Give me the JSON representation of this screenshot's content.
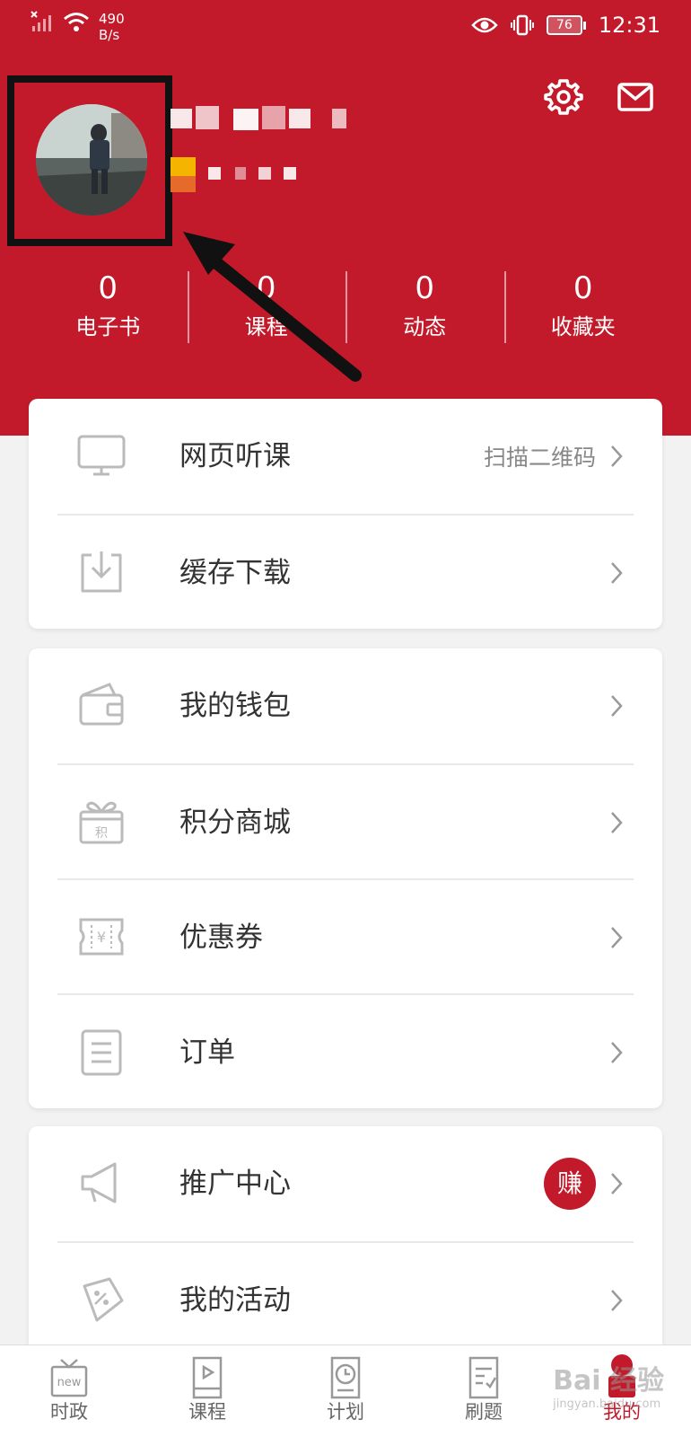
{
  "status_bar": {
    "net_speed_value": "490",
    "net_speed_unit": "B/s",
    "battery": "76",
    "time": "12:31"
  },
  "profile": {
    "stats": [
      {
        "value": "0",
        "label": "电子书"
      },
      {
        "value": "0",
        "label": "课程"
      },
      {
        "value": "0",
        "label": "动态"
      },
      {
        "value": "0",
        "label": "收藏夹"
      }
    ]
  },
  "cards": {
    "group1": [
      {
        "label": "网页听课",
        "hint": "扫描二维码",
        "icon": "monitor-icon"
      },
      {
        "label": "缓存下载",
        "icon": "download-icon"
      }
    ],
    "group2": [
      {
        "label": "我的钱包",
        "icon": "wallet-icon"
      },
      {
        "label": "积分商城",
        "icon": "gift-icon",
        "icon_text": "积"
      },
      {
        "label": "优惠券",
        "icon": "coupon-icon",
        "icon_text": "¥"
      },
      {
        "label": "订单",
        "icon": "order-icon"
      }
    ],
    "group3": [
      {
        "label": "推广中心",
        "badge": "赚",
        "icon": "megaphone-icon"
      },
      {
        "label": "我的活动",
        "icon": "activity-icon"
      }
    ]
  },
  "tabbar": {
    "tabs": [
      {
        "label": "时政",
        "icon_text": "new"
      },
      {
        "label": "课程"
      },
      {
        "label": "计划"
      },
      {
        "label": "刷题"
      },
      {
        "label": "我的",
        "active": true
      }
    ]
  },
  "watermark": {
    "text": "Bai  经验",
    "sub": "jingyan.baidu.com"
  },
  "colors": {
    "brand": "#c21a2a",
    "background": "#f2f2f2",
    "annotation": "#111111"
  }
}
